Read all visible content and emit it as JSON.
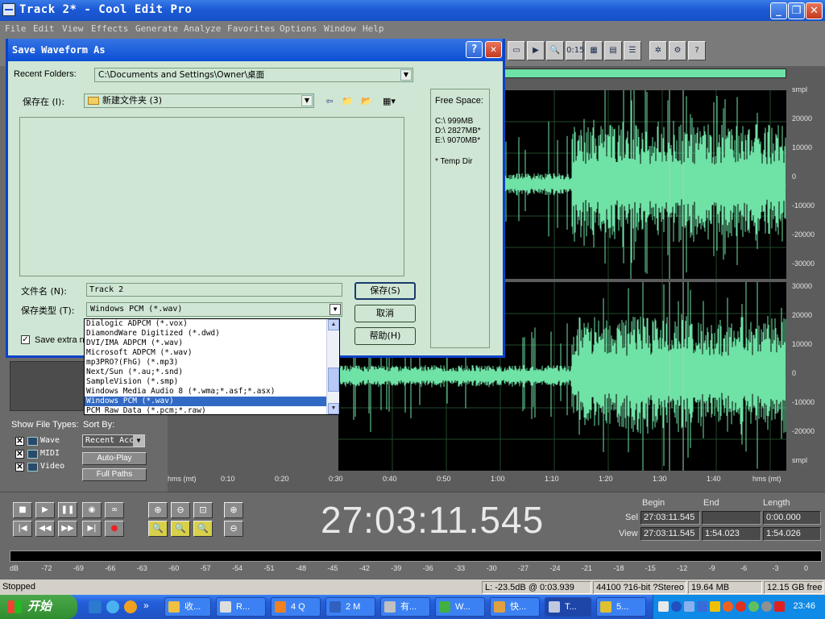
{
  "window": {
    "title": "Track 2* - Cool Edit Pro"
  },
  "menu": [
    "File",
    "Edit",
    "View",
    "Effects",
    "Generate",
    "Analyze",
    "Favorites",
    "Options",
    "Window",
    "Help"
  ],
  "waveform": {
    "scale_top": [
      "smpl",
      "20000",
      "10000",
      "0",
      "-10000",
      "-20000",
      "-30000"
    ],
    "scale_bottom": [
      "30000",
      "20000",
      "10000",
      "0",
      "-10000",
      "-20000",
      "smpl"
    ],
    "wave_color": "#6fe2a6",
    "timeline": [
      "hms (mt)",
      "0:10",
      "0:20",
      "0:30",
      "0:40",
      "0:50",
      "1:00",
      "1:10",
      "1:20",
      "1:30",
      "1:40",
      "hms (mt)"
    ]
  },
  "organizer": {
    "show_file_types_label": "Show File Types:",
    "sort_by_label": "Sort By:",
    "sort_value": "Recent Acc",
    "types": [
      "Wave",
      "MIDI",
      "Video"
    ],
    "auto_play": "Auto-Play",
    "full_paths": "Full Paths"
  },
  "time": {
    "display": "27:03:11.545",
    "begin_label": "Begin",
    "end_label": "End",
    "length_label": "Length",
    "sel_label": "Sel",
    "view_label": "View",
    "sel_begin": "27:03:11.545",
    "sel_end": "",
    "sel_length": "0:00.000",
    "view_begin": "27:03:11.545",
    "view_end": "1:54.023",
    "view_length": "1:54.026"
  },
  "meter_ticks": [
    "dB",
    "-72",
    "-69",
    "-66",
    "-63",
    "-60",
    "-57",
    "-54",
    "-51",
    "-48",
    "-45",
    "-42",
    "-39",
    "-36",
    "-33",
    "-30",
    "-27",
    "-24",
    "-21",
    "-18",
    "-15",
    "-12",
    "-9",
    "-6",
    "-3",
    "0"
  ],
  "status": {
    "state": "Stopped",
    "level": "L: -23.5dB @  0:03.939",
    "format": "44100 ?16-bit ?Stereo",
    "size": "19.64 MB",
    "free": "12.15 GB free"
  },
  "dialog": {
    "title": "Save Waveform As",
    "recent_label": "Recent Folders:",
    "recent_value": "C:\\Documents and Settings\\Owner\\桌面",
    "save_in_label": "保存在 (I):",
    "save_in_value": "新建文件夹 (3)",
    "filename_label": "文件名 (N):",
    "filename_value": "Track 2",
    "type_label": "保存类型 (T):",
    "type_value": "Windows PCM (*.wav)",
    "save_btn": "保存(S)",
    "cancel_btn": "取消",
    "help_btn": "帮助(H)",
    "save_extra": "Save extra no",
    "free_space_label": "Free Space:",
    "drives": [
      "C:\\  999MB",
      "D:\\  2827MB*",
      "E:\\  9070MB*"
    ],
    "temp_note": "* Temp Dir",
    "type_options": [
      "Dialogic ADPCM (*.vox)",
      "DiamondWare Digitized (*.dwd)",
      "DVI/IMA ADPCM (*.wav)",
      "Microsoft ADPCM (*.wav)",
      "mp3PRO?(FhG) (*.mp3)",
      "Next/Sun (*.au;*.snd)",
      "SampleVision (*.smp)",
      "Windows Media Audio 8 (*.wma;*.asf;*.asx)",
      "Windows PCM (*.wav)",
      "PCM Raw Data (*.pcm;*.raw)"
    ],
    "selected_option": 8
  },
  "taskbar": {
    "start": "开始",
    "tasks": [
      "收...",
      "R...",
      "4 Q",
      "2 M",
      "有...",
      "W...",
      "快...",
      "T...",
      "5..."
    ],
    "clock": "23:46"
  }
}
